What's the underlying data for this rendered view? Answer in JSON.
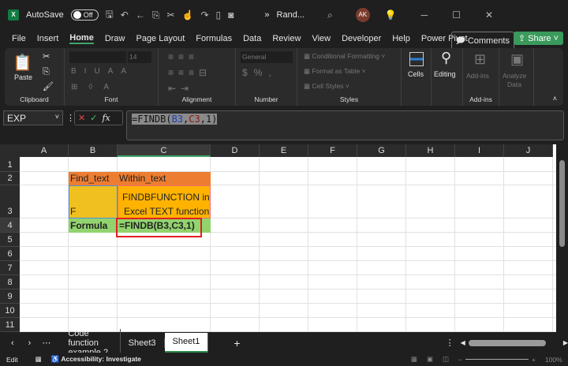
{
  "titlebar": {
    "app_icon": "excel-icon",
    "autosave_label": "AutoSave",
    "autosave_state": "Off",
    "filename": "Rand...",
    "avatar": "AK",
    "more": "»"
  },
  "menu": {
    "tabs": [
      "File",
      "Insert",
      "Home",
      "Draw",
      "Page Layout",
      "Formulas",
      "Data",
      "Review",
      "View",
      "Developer",
      "Help",
      "Power Pivot"
    ],
    "active": "Home",
    "comments": "Comments",
    "share": "Share"
  },
  "ribbon": {
    "clipboard": {
      "paste": "Paste",
      "label": "Clipboard"
    },
    "font": {
      "name": "",
      "size": "14",
      "label": "Font"
    },
    "alignment": {
      "label": "Alignment"
    },
    "number": {
      "format": "General",
      "label": "Number"
    },
    "styles": {
      "conditional": "Conditional Formatting",
      "format_table": "Format as Table",
      "cell_styles": "Cell Styles",
      "label": "Styles"
    },
    "cells": {
      "label": "Cells"
    },
    "editing": {
      "label": "Editing"
    },
    "addins": {
      "button": "Add-ins",
      "label": "Add-ins"
    },
    "analyze": {
      "line1": "Analyze",
      "line2": "Data"
    }
  },
  "formula_bar": {
    "name_box": "EXP",
    "fx": "fx",
    "formula_prefix": "=FINDB(",
    "ref1": "B3",
    "sep1": ",",
    "ref2": "C3",
    "suffix": ",1)"
  },
  "grid": {
    "columns": [
      "A",
      "B",
      "C",
      "D",
      "E",
      "F",
      "G",
      "H",
      "I",
      "J"
    ],
    "rows": [
      "1",
      "2",
      "3",
      "4",
      "5",
      "6",
      "7",
      "8",
      "9",
      "10",
      "11"
    ],
    "cells": {
      "B2": "Find_text",
      "C2": "Within_text",
      "B3": "F",
      "C3_line1": "FINDBFUNCTION in",
      "C3_line2": "Excel TEXT function",
      "B4": "Formula",
      "C4": "=FINDB(B3,C3,1)"
    },
    "colors": {
      "header_orange": "#ed7d31",
      "b3_yellow": "#f0c020",
      "c3_orange": "#ffb300",
      "row4_green": "#92d36e",
      "highlight_red": "#e02020"
    }
  },
  "sheets": {
    "tabs": [
      "Code function example 2",
      "Sheet3",
      "Sheet1"
    ],
    "active": "Sheet1",
    "add": "+"
  },
  "status": {
    "mode": "Edit",
    "accessibility": "Accessibility: Investigate",
    "zoom": "100%"
  }
}
